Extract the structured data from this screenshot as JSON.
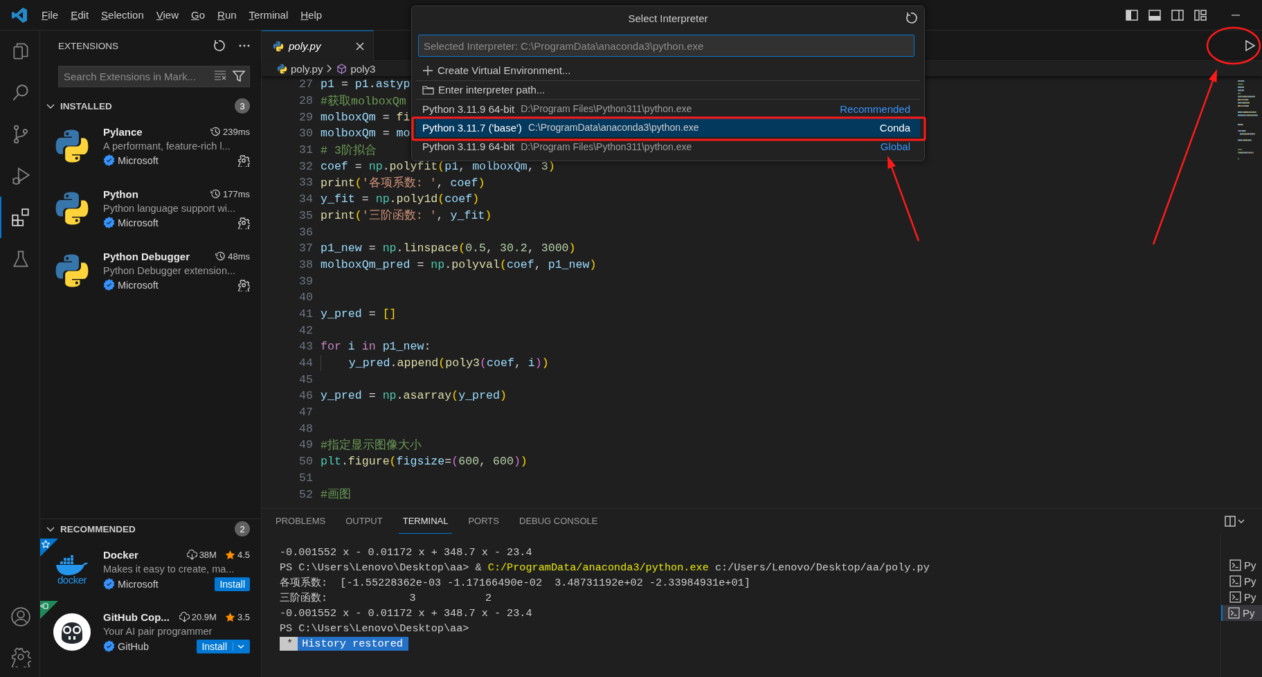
{
  "title_bar": {
    "menus": [
      "File",
      "Edit",
      "Selection",
      "View",
      "Go",
      "Run",
      "Terminal",
      "Help"
    ]
  },
  "activity_bar": {
    "items": [
      {
        "kind": "explorer",
        "selected": false
      },
      {
        "kind": "search",
        "selected": false
      },
      {
        "kind": "source-control",
        "selected": false
      },
      {
        "kind": "run-debug",
        "selected": false
      },
      {
        "kind": "extensions",
        "selected": true
      },
      {
        "kind": "testing",
        "selected": false
      }
    ],
    "bottom": [
      {
        "kind": "accounts"
      },
      {
        "kind": "manage"
      }
    ]
  },
  "sidebar": {
    "title": "EXTENSIONS",
    "search": {
      "placeholder": "Search Extensions in Mark..."
    },
    "sections": [
      {
        "title": "INSTALLED",
        "count": "3",
        "expanded": true,
        "items": [
          {
            "kind": "python",
            "name": "Pylance",
            "time": "239ms",
            "description": "A performant, feature-rich l...",
            "publisher": "Microsoft"
          },
          {
            "kind": "python",
            "name": "Python",
            "time": "177ms",
            "description": "Python language support wi...",
            "publisher": "Microsoft"
          },
          {
            "kind": "python",
            "name": "Python Debugger",
            "time": "48ms",
            "description": "Python Debugger extension...",
            "publisher": "Microsoft"
          }
        ]
      },
      {
        "title": "RECOMMENDED",
        "count": "2",
        "expanded": true,
        "items": [
          {
            "kind": "docker",
            "logo_text": "docker",
            "corner": {
              "kind": "recommended"
            },
            "name": "Docker",
            "downloads": "38M",
            "rating": "4.5",
            "description": "Makes it easy to create, ma...",
            "publisher": "Microsoft",
            "install": "Install",
            "install_menu": false
          },
          {
            "kind": "copilot",
            "corner": {
              "kind": "pre-release"
            },
            "name": "GitHub Cop...",
            "downloads": "20.9M",
            "rating": "3.5",
            "description": "Your AI pair programmer",
            "publisher": "GitHub",
            "install": "Install",
            "install_menu": true
          }
        ]
      }
    ]
  },
  "editor": {
    "tabs": [
      {
        "label": "poly.py",
        "selected": true,
        "preview": true
      }
    ],
    "breadcrumbs": [
      {
        "kind": "file",
        "label": "poly.py"
      },
      {
        "kind": "symbol",
        "label": "poly3"
      }
    ],
    "lines": [
      {
        "no": "27",
        "tokens": [
          {
            "kind": "var",
            "text": "p1"
          },
          {
            "kind": "op",
            "text": " = "
          },
          {
            "kind": "var",
            "text": "p1"
          },
          {
            "kind": "op",
            "text": "."
          },
          {
            "kind": "var",
            "text": "astyp"
          }
        ]
      },
      {
        "no": "28",
        "tokens": [
          {
            "kind": "comment",
            "text": "#获取molboxQm"
          }
        ]
      },
      {
        "no": "29",
        "tokens": [
          {
            "kind": "var",
            "text": "molboxQm"
          },
          {
            "kind": "op",
            "text": " = "
          },
          {
            "kind": "fn",
            "text": "fi"
          }
        ]
      },
      {
        "no": "30",
        "tokens": [
          {
            "kind": "var",
            "text": "molboxQm"
          },
          {
            "kind": "op",
            "text": " = "
          },
          {
            "kind": "var",
            "text": "mo"
          }
        ]
      },
      {
        "no": "31",
        "tokens": [
          {
            "kind": "comment",
            "text": "# 3阶拟合"
          }
        ]
      },
      {
        "no": "32",
        "tokens": [
          {
            "kind": "var",
            "text": "coef"
          },
          {
            "kind": "op",
            "text": " = "
          },
          {
            "kind": "mod",
            "text": "np"
          },
          {
            "kind": "op",
            "text": "."
          },
          {
            "kind": "fn",
            "text": "polyfit"
          },
          {
            "kind": "b1",
            "text": "("
          },
          {
            "kind": "var",
            "text": "p1"
          },
          {
            "kind": "op",
            "text": ", "
          },
          {
            "kind": "var",
            "text": "molboxQm"
          },
          {
            "kind": "op",
            "text": ", "
          },
          {
            "kind": "num",
            "text": "3"
          },
          {
            "kind": "b1",
            "text": ")"
          }
        ]
      },
      {
        "no": "33",
        "tokens": [
          {
            "kind": "fn",
            "text": "print"
          },
          {
            "kind": "b1",
            "text": "("
          },
          {
            "kind": "str",
            "text": "'各项系数: '"
          },
          {
            "kind": "op",
            "text": ", "
          },
          {
            "kind": "var",
            "text": "coef"
          },
          {
            "kind": "b1",
            "text": ")"
          }
        ]
      },
      {
        "no": "34",
        "tokens": [
          {
            "kind": "var",
            "text": "y_fit"
          },
          {
            "kind": "op",
            "text": " = "
          },
          {
            "kind": "mod",
            "text": "np"
          },
          {
            "kind": "op",
            "text": "."
          },
          {
            "kind": "fn",
            "text": "poly1d"
          },
          {
            "kind": "b1",
            "text": "("
          },
          {
            "kind": "var",
            "text": "coef"
          },
          {
            "kind": "b1",
            "text": ")"
          }
        ]
      },
      {
        "no": "35",
        "tokens": [
          {
            "kind": "fn",
            "text": "print"
          },
          {
            "kind": "b1",
            "text": "("
          },
          {
            "kind": "str",
            "text": "'三阶函数: '"
          },
          {
            "kind": "op",
            "text": ", "
          },
          {
            "kind": "var",
            "text": "y_fit"
          },
          {
            "kind": "b1",
            "text": ")"
          }
        ]
      },
      {
        "no": "36"
      },
      {
        "no": "37",
        "tokens": [
          {
            "kind": "var",
            "text": "p1_new"
          },
          {
            "kind": "op",
            "text": " = "
          },
          {
            "kind": "mod",
            "text": "np"
          },
          {
            "kind": "op",
            "text": "."
          },
          {
            "kind": "fn",
            "text": "linspace"
          },
          {
            "kind": "b1",
            "text": "("
          },
          {
            "kind": "num",
            "text": "0.5"
          },
          {
            "kind": "op",
            "text": ", "
          },
          {
            "kind": "num",
            "text": "30.2"
          },
          {
            "kind": "op",
            "text": ", "
          },
          {
            "kind": "num",
            "text": "3000"
          },
          {
            "kind": "b1",
            "text": ")"
          }
        ]
      },
      {
        "no": "38",
        "tokens": [
          {
            "kind": "var",
            "text": "molboxQm_pred"
          },
          {
            "kind": "op",
            "text": " = "
          },
          {
            "kind": "mod",
            "text": "np"
          },
          {
            "kind": "op",
            "text": "."
          },
          {
            "kind": "fn",
            "text": "polyval"
          },
          {
            "kind": "b1",
            "text": "("
          },
          {
            "kind": "var",
            "text": "coef"
          },
          {
            "kind": "op",
            "text": ", "
          },
          {
            "kind": "var",
            "text": "p1_new"
          },
          {
            "kind": "b1",
            "text": ")"
          }
        ]
      },
      {
        "no": "39"
      },
      {
        "no": "40"
      },
      {
        "no": "41",
        "tokens": [
          {
            "kind": "var",
            "text": "y_pred"
          },
          {
            "kind": "op",
            "text": " = "
          },
          {
            "kind": "b1",
            "text": "[]"
          }
        ]
      },
      {
        "no": "42"
      },
      {
        "no": "43",
        "tokens": [
          {
            "kind": "kw",
            "text": "for"
          },
          {
            "kind": "var",
            "text": " i "
          },
          {
            "kind": "kw",
            "text": "in"
          },
          {
            "kind": "var",
            "text": " p1_new"
          },
          {
            "kind": "op",
            "text": ":"
          }
        ]
      },
      {
        "no": "44",
        "indented": true,
        "tokens": [
          {
            "kind": "var",
            "text": "y_pred"
          },
          {
            "kind": "op",
            "text": "."
          },
          {
            "kind": "fn",
            "text": "append"
          },
          {
            "kind": "b1",
            "text": "("
          },
          {
            "kind": "fn",
            "text": "poly3"
          },
          {
            "kind": "b2",
            "text": "("
          },
          {
            "kind": "var",
            "text": "coef"
          },
          {
            "kind": "op",
            "text": ", "
          },
          {
            "kind": "var",
            "text": "i"
          },
          {
            "kind": "b2",
            "text": ")"
          },
          {
            "kind": "b1",
            "text": ")"
          }
        ]
      },
      {
        "no": "45"
      },
      {
        "no": "46",
        "tokens": [
          {
            "kind": "var",
            "text": "y_pred"
          },
          {
            "kind": "op",
            "text": " = "
          },
          {
            "kind": "mod",
            "text": "np"
          },
          {
            "kind": "op",
            "text": "."
          },
          {
            "kind": "fn",
            "text": "asarray"
          },
          {
            "kind": "b1",
            "text": "("
          },
          {
            "kind": "var",
            "text": "y_pred"
          },
          {
            "kind": "b1",
            "text": ")"
          }
        ]
      },
      {
        "no": "47"
      },
      {
        "no": "48"
      },
      {
        "no": "49",
        "tokens": [
          {
            "kind": "comment",
            "text": "#指定显示图像大小"
          }
        ]
      },
      {
        "no": "50",
        "tokens": [
          {
            "kind": "mod",
            "text": "plt"
          },
          {
            "kind": "op",
            "text": "."
          },
          {
            "kind": "fn",
            "text": "figure"
          },
          {
            "kind": "b1",
            "text": "("
          },
          {
            "kind": "var",
            "text": "figsize"
          },
          {
            "kind": "op",
            "text": "="
          },
          {
            "kind": "b2",
            "text": "("
          },
          {
            "kind": "num",
            "text": "600"
          },
          {
            "kind": "op",
            "text": ", "
          },
          {
            "kind": "num",
            "text": "600"
          },
          {
            "kind": "b2",
            "text": ")"
          },
          {
            "kind": "b1",
            "text": ")"
          }
        ]
      },
      {
        "no": "51"
      },
      {
        "no": "52",
        "tokens": [
          {
            "kind": "comment",
            "text": "#画图"
          }
        ]
      }
    ]
  },
  "quick_pick": {
    "title": "Select Interpreter",
    "input": {
      "placeholder": "Selected Interpreter: C:\\ProgramData\\anaconda3\\python.exe"
    },
    "items": [
      {
        "kind": "new-environment",
        "label": "Create Virtual Environment...",
        "selected": false
      },
      {
        "kind": "enter-path",
        "label": "Enter interpreter path...",
        "selected": false
      },
      {
        "kind": "interpreter",
        "label": "Python 3.11.9 64-bit",
        "path": "D:\\Program Files\\Python311\\python.exe",
        "tag": "Recommended",
        "selected": false
      },
      {
        "kind": "interpreter",
        "label": "Python 3.11.7 ('base')",
        "path": "C:\\ProgramData\\anaconda3\\python.exe",
        "tag": "Conda",
        "selected": true
      },
      {
        "kind": "interpreter",
        "label": "Python 3.11.9 64-bit",
        "path": "D:\\Program Files\\Python311\\python.exe",
        "tag": "Global",
        "selected": false
      }
    ]
  },
  "panel": {
    "tabs": [
      {
        "label": "PROBLEMS",
        "selected": false
      },
      {
        "label": "OUTPUT",
        "selected": false
      },
      {
        "label": "TERMINAL",
        "selected": true
      },
      {
        "label": "PORTS",
        "selected": false
      },
      {
        "label": "DEBUG CONSOLE",
        "selected": false
      }
    ],
    "terminal": [
      {
        "segments": [
          {
            "kind": "plain",
            "text": "-0.001552 x - 0.01172 x + 348.7 x - 23.4"
          }
        ]
      },
      {
        "segments": [
          {
            "kind": "plain",
            "text": "PS C:\\Users\\Lenovo\\Desktop\\aa> & "
          },
          {
            "kind": "command",
            "text": "C:/ProgramData/anaconda3/python.exe"
          },
          {
            "kind": "plain",
            "text": " c:/Users/Lenovo/Desktop/aa/poly.py"
          }
        ]
      },
      {
        "segments": [
          {
            "kind": "plain",
            "text": "各项系数:  [-1.55228362e-03 -1.17166490e-02  3.48731192e+02 -2.33984931e+01]"
          }
        ]
      },
      {
        "segments": [
          {
            "kind": "plain",
            "text": "三阶函数:             3           2"
          }
        ]
      },
      {
        "segments": [
          {
            "kind": "plain",
            "text": "-0.001552 x - 0.01172 x + 348.7 x - 23.4"
          }
        ]
      },
      {
        "segments": [
          {
            "kind": "plain",
            "text": "PS C:\\Users\\Lenovo\\Desktop\\aa>"
          }
        ]
      }
    ],
    "history": {
      "marker": "*",
      "text": "History restored"
    },
    "terminals": [
      {
        "label": "Py",
        "selected": false
      },
      {
        "label": "Py",
        "selected": false
      },
      {
        "label": "Py",
        "selected": false
      },
      {
        "label": "Py",
        "selected": true
      }
    ]
  },
  "annotations": [
    {
      "kind": "frame"
    },
    {
      "kind": "ellipse"
    },
    {
      "kind": "arrow"
    },
    {
      "kind": "arrow"
    }
  ]
}
